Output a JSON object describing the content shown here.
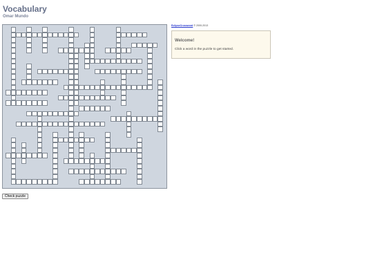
{
  "header": {
    "title": "Vocabulary",
    "author": "Omar Mundo"
  },
  "credit": {
    "link_text": "EclipseCrossword",
    "suffix": " © 2000-2013"
  },
  "welcome": {
    "title": "Welcome!",
    "message": "Click a word in the puzzle to get started."
  },
  "actions": {
    "check_label": "Check puzzle"
  },
  "colors": {
    "grid_background": "#cfd6df",
    "cell_background": "#ffffff",
    "title_color": "#66708a",
    "welcome_background": "#fdf9ec"
  }
}
